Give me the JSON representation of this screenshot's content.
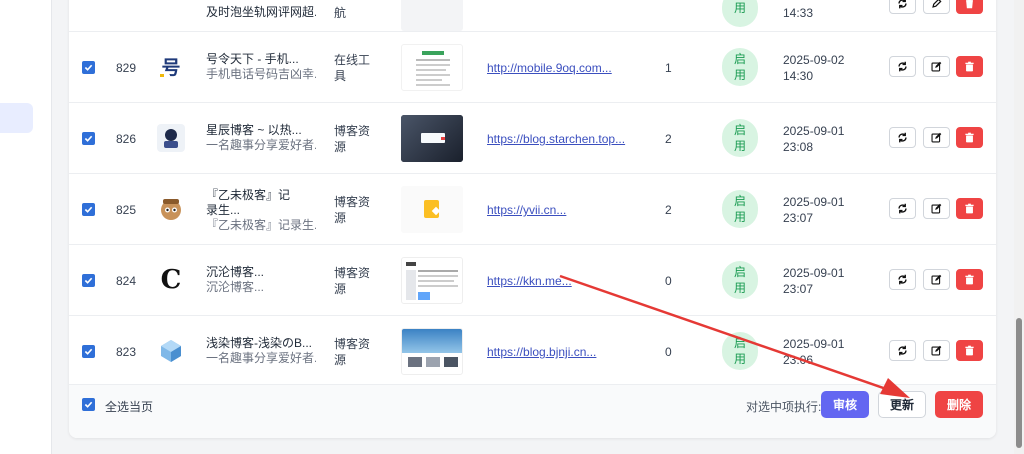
{
  "rows": [
    {
      "id": "",
      "title": "及时泡坐轨网评网超...",
      "desc": "",
      "category": "航",
      "status": "用",
      "date": "14:33",
      "url": ""
    },
    {
      "id": "829",
      "title": "号令天下 - 手机...",
      "desc": "手机电话号码吉凶幸...",
      "category": "在线工具",
      "url": "http://mobile.9oq.com...",
      "count": "1",
      "status": "启用",
      "date": "2025-09-02 14:30"
    },
    {
      "id": "826",
      "title": "星辰博客 ~ 以热...",
      "desc": "一名趣事分享爱好者...",
      "category": "博客资源",
      "url": "https://blog.starchen.top...",
      "count": "2",
      "status": "启用",
      "date": "2025-09-01 23:08"
    },
    {
      "id": "825",
      "title": "『乙未极客』记录生...",
      "desc": "『乙未极客』记录生...",
      "category": "博客资源",
      "url": "https://yvii.cn...",
      "count": "2",
      "status": "启用",
      "date": "2025-09-01 23:07"
    },
    {
      "id": "824",
      "title": "沉沦博客...",
      "desc": "沉沦博客...",
      "category": "博客资源",
      "url": "https://kkn.me...",
      "count": "0",
      "status": "启用",
      "date": "2025-09-01 23:07",
      "logo_text": "C"
    },
    {
      "id": "823",
      "title": "浅染博客-浅染のB...",
      "desc": "一名趣事分享爱好者...",
      "category": "博客资源",
      "url": "https://blog.bjnji.cn...",
      "count": "0",
      "status": "启用",
      "date": "2025-09-01 23:06"
    }
  ],
  "footer": {
    "select_all_label": "全选当页",
    "bulk_label": "对选中项执行:",
    "review_label": "审核",
    "update_label": "更新",
    "delete_label": "删除"
  },
  "colors": {
    "accent": "#6366f1",
    "danger": "#ef4444",
    "status_bg": "#d8f4e2",
    "status_text": "#1a9b52",
    "checkbox": "#2f6fd8",
    "annotation_arrow": "#e53935"
  },
  "icons": {
    "refresh": "refresh-icon",
    "edit": "edit-icon",
    "delete": "trash-icon",
    "check": "check-icon"
  }
}
